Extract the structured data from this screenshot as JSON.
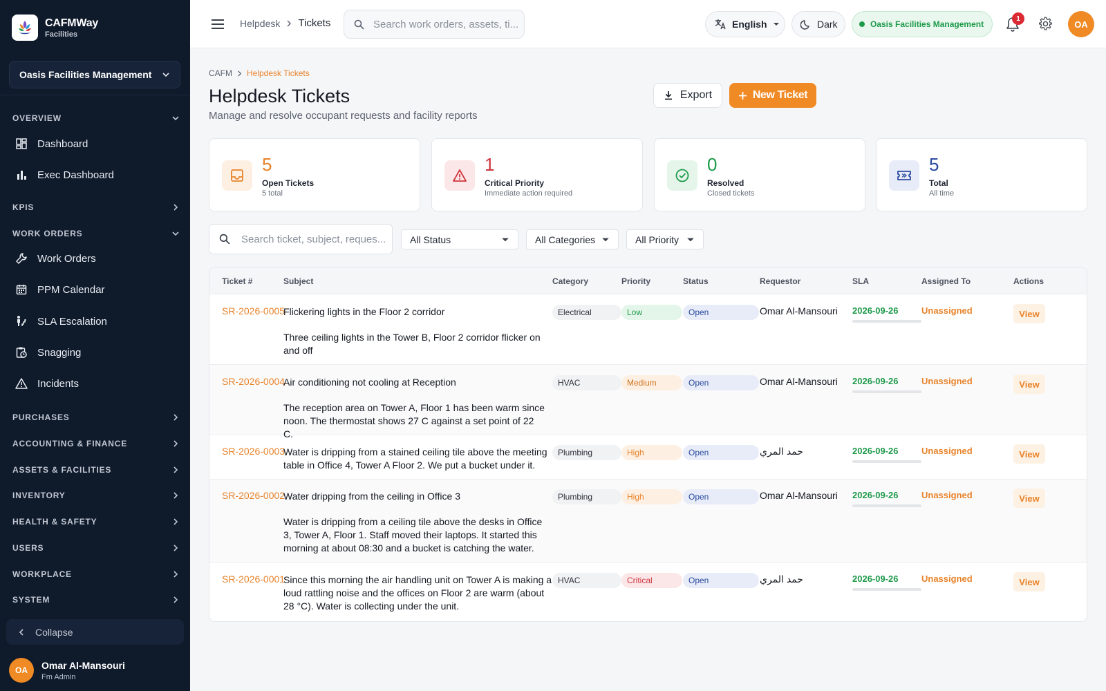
{
  "brand": {
    "name": "CAFMWay",
    "sub": "Facilities"
  },
  "sidebar": {
    "org": "Oasis Facilities Management",
    "sections": {
      "overview": "OVERVIEW",
      "kpis": "KPIS",
      "work_orders": "WORK ORDERS",
      "purchases": "PURCHASES",
      "accounting": "ACCOUNTING & FINANCE",
      "assets": "ASSETS & FACILITIES",
      "inventory": "INVENTORY",
      "health": "HEALTH & SAFETY",
      "users": "USERS",
      "workplace": "WORKPLACE",
      "system": "SYSTEM"
    },
    "items": {
      "dashboard": "Dashboard",
      "exec": "Exec Dashboard",
      "work_orders": "Work Orders",
      "ppm": "PPM Calendar",
      "sla": "SLA Escalation",
      "snagging": "Snagging",
      "incidents": "Incidents"
    },
    "collapse": "Collapse",
    "user": {
      "initials": "OA",
      "name": "Omar Al-Mansouri",
      "role": "Fm Admin"
    }
  },
  "topbar": {
    "crumb_parent": "Helpdesk",
    "crumb_current": "Tickets",
    "search_placeholder": "Search work orders, assets, ti...",
    "language": "English",
    "theme": "Dark",
    "org": "Oasis Facilities Management",
    "notifications": "1",
    "avatar": "OA"
  },
  "page": {
    "crumb_root": "CAFM",
    "crumb_current": "Helpdesk Tickets",
    "title": "Helpdesk Tickets",
    "subtitle": "Manage and resolve occupant requests and facility reports",
    "export": "Export",
    "new_ticket": "New Ticket"
  },
  "stats": [
    {
      "value": "5",
      "label": "Open Tickets",
      "sub": "5 total",
      "color": "#e8832a",
      "bg": "#fdf0e3"
    },
    {
      "value": "1",
      "label": "Critical Priority",
      "sub": "Immediate action required",
      "color": "#d0343d",
      "bg": "#fbe7e8"
    },
    {
      "value": "0",
      "label": "Resolved",
      "sub": "Closed tickets",
      "color": "#1e9a4a",
      "bg": "#e6f5ea"
    },
    {
      "value": "5",
      "label": "Total",
      "sub": "All time",
      "color": "#2b4aa0",
      "bg": "#e7ecf8"
    }
  ],
  "filters": {
    "search_placeholder": "Search ticket, subject, reques...",
    "status": "All Status",
    "category": "All Categories",
    "priority": "All Priority"
  },
  "table": {
    "headers": [
      "Ticket #",
      "Subject",
      "Category",
      "Priority",
      "Status",
      "Requestor",
      "SLA",
      "Assigned To",
      "Actions"
    ],
    "rows": [
      {
        "id": "SR-2026-0005",
        "subject": "Flickering lights in the Floor 2 corridor",
        "description": "Three ceiling lights in the Tower B, Floor 2 corridor flicker on and off",
        "category": "Electrical",
        "priority": "Low",
        "status": "Open",
        "requestor": "Omar Al-Mansouri",
        "sla": "2026-09-26",
        "assigned": "Unassigned",
        "action": "View"
      },
      {
        "id": "SR-2026-0004",
        "subject": "Air conditioning not cooling at Reception",
        "description": "The reception area on Tower A, Floor 1 has been warm since noon. The thermostat shows 27 C against a set point of 22 C.",
        "category": "HVAC",
        "priority": "Medium",
        "status": "Open",
        "requestor": "Omar Al-Mansouri",
        "sla": "2026-09-26",
        "assigned": "Unassigned",
        "action": "View"
      },
      {
        "id": "SR-2026-0003",
        "subject": "Water is dripping from a stained ceiling tile above the meeting table in Office 4, Tower A Floor 2. We put a bucket under it.",
        "description": "",
        "category": "Plumbing",
        "priority": "High",
        "status": "Open",
        "requestor": "حمد المري",
        "sla": "2026-09-26",
        "assigned": "Unassigned",
        "action": "View"
      },
      {
        "id": "SR-2026-0002",
        "subject": "Water dripping from the ceiling in Office 3",
        "description": "Water is dripping from a ceiling tile above the desks in Office 3, Tower A, Floor 1. Staff moved their laptops. It started this morning at about 08:30 and a bucket is catching the water.",
        "category": "Plumbing",
        "priority": "High",
        "status": "Open",
        "requestor": "Omar Al-Mansouri",
        "sla": "2026-09-26",
        "assigned": "Unassigned",
        "action": "View"
      },
      {
        "id": "SR-2026-0001",
        "subject": "Since this morning the air handling unit on Tower A is making a loud rattling noise and the offices on Floor 2 are warm (about 28 °C). Water is collecting under the unit.",
        "description": "",
        "category": "HVAC",
        "priority": "Critical",
        "status": "Open",
        "requestor": "حمد المري",
        "sla": "2026-09-26",
        "assigned": "Unassigned",
        "action": "View"
      }
    ]
  },
  "priority_colors": {
    "Low": {
      "bg": "#e4f5e9",
      "fg": "#1e9a4a"
    },
    "Medium": {
      "bg": "#fdf0e3",
      "fg": "#d2721c"
    },
    "High": {
      "bg": "#fdf0e3",
      "fg": "#e8832a"
    },
    "Critical": {
      "bg": "#fbe7e8",
      "fg": "#d0343d"
    }
  }
}
